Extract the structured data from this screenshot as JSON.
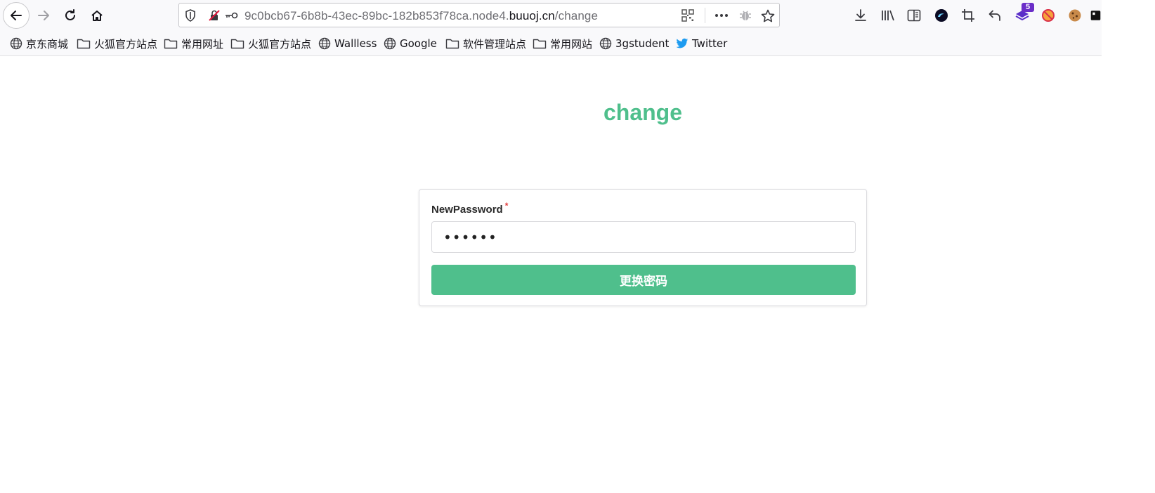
{
  "browser": {
    "url_prefix": "9c0bcb67-6b8b-43ec-89bc-182b853f78ca.node4.",
    "url_host": "buuoj.cn",
    "url_path": "/change",
    "extension_badge": "5"
  },
  "bookmarks": [
    {
      "label": "京东商城",
      "icon": "globe-icon"
    },
    {
      "label": "火狐官方站点",
      "icon": "folder-icon"
    },
    {
      "label": "常用网址",
      "icon": "folder-icon"
    },
    {
      "label": "火狐官方站点",
      "icon": "folder-icon"
    },
    {
      "label": "Wallless",
      "icon": "globe-icon"
    },
    {
      "label": "Google",
      "icon": "globe-icon"
    },
    {
      "label": "软件管理站点",
      "icon": "folder-icon"
    },
    {
      "label": "常用网站",
      "icon": "folder-icon"
    },
    {
      "label": "3gstudent",
      "icon": "globe-icon"
    },
    {
      "label": "Twitter",
      "icon": "twitter-bird-icon"
    }
  ],
  "page": {
    "title": "change",
    "form": {
      "label": "NewPassword",
      "required_mark": "*",
      "password_value": "123456",
      "submit_label": "更换密码"
    }
  },
  "colors": {
    "accent": "#4fbf8c",
    "required": "#e23a3a",
    "badge": "#6b2ec8"
  }
}
